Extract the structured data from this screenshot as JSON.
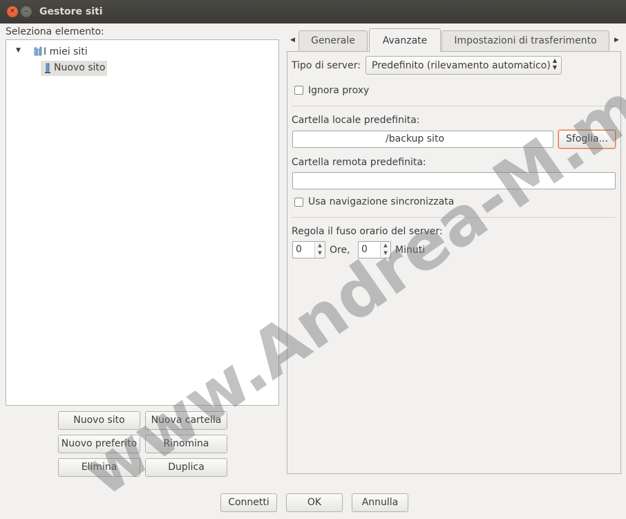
{
  "window": {
    "title": "Gestore siti"
  },
  "left": {
    "select_label": "Seleziona elemento:",
    "tree": {
      "root": "I miei siti",
      "child": "Nuovo sito"
    },
    "buttons": {
      "new_site": "Nuovo sito",
      "new_folder": "Nuova cartella",
      "new_bookmark": "Nuovo preferito",
      "rename": "Rinomina",
      "delete": "Elimina",
      "duplicate": "Duplica"
    }
  },
  "tabs": [
    {
      "label": "Generale"
    },
    {
      "label": "Avanzate",
      "active": true
    },
    {
      "label": "Impostazioni di trasferimento"
    }
  ],
  "advanced": {
    "server_type_label": "Tipo di server:",
    "server_type_value": "Predefinito (rilevamento automatico)",
    "ignore_proxy_label": "Ignora proxy",
    "local_folder_label": "Cartella locale predefinita:",
    "local_folder_value": "/backup sito",
    "browse_button": "Sfoglia...",
    "remote_folder_label": "Cartella remota predefinita:",
    "remote_folder_value": "",
    "sync_nav_label": "Usa navigazione sincronizzata",
    "timezone_label": "Regola il fuso orario del server:",
    "hours_value": "0",
    "hours_label": "Ore,",
    "minutes_value": "0",
    "minutes_label": "Minuti"
  },
  "footer": {
    "connect": "Connetti",
    "ok": "OK",
    "cancel": "Annulla"
  },
  "watermark": "www.Andrea-M.me"
}
